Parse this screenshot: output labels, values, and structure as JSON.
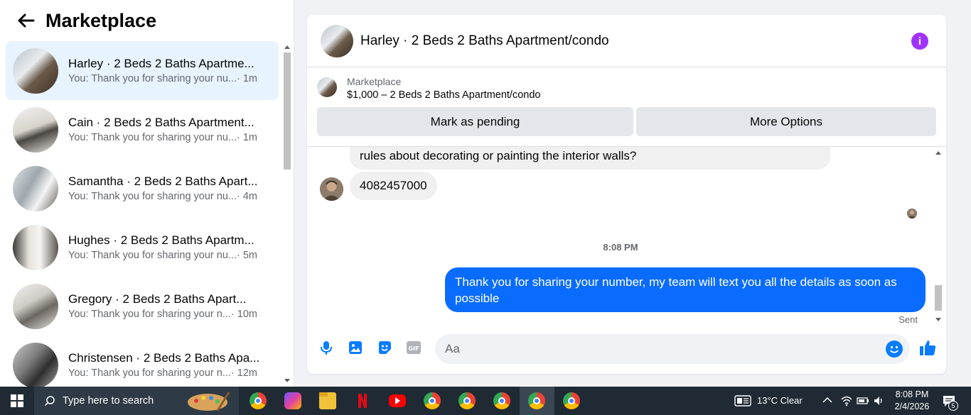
{
  "left": {
    "title": "Marketplace",
    "conversations": [
      {
        "title": "Harley · 2 Beds 2 Baths Apartme...",
        "snippet": "You: Thank you for sharing your nu...",
        "time": "· 1m",
        "active": true
      },
      {
        "title": "Cain · 2 Beds 2 Baths Apartment...",
        "snippet": "You: Thank you for sharing your nu...",
        "time": "· 1m"
      },
      {
        "title": "Samantha · 2 Beds 2 Baths Apart...",
        "snippet": "You: Thank you for sharing your nu...",
        "time": "· 4m"
      },
      {
        "title": "Hughes · 2 Beds 2 Baths Apartm...",
        "snippet": "You: Thank you for sharing your nu...",
        "time": "· 5m"
      },
      {
        "title": "Gregory · 2 Beds 2 Baths Apart...",
        "snippet": "You: Thank you for sharing your n...",
        "time": "· 10m"
      },
      {
        "title": "Christensen · 2 Beds 2 Baths Apa...",
        "snippet": "You: Thank you for sharing your n...",
        "time": "· 12m"
      }
    ]
  },
  "chat": {
    "title": "Harley · 2 Beds 2 Baths Apartment/condo",
    "listing_label": "Marketplace",
    "listing_price": "$1,000 – 2 Beds 2 Baths Apartment/condo",
    "mark_pending": "Mark as pending",
    "more_options": "More Options",
    "msg_in1": "rules about decorating or painting the interior walls?",
    "msg_in2": "4082457000",
    "timestamp": "8:08 PM",
    "msg_out": "Thank you for  sharing your number, my team will text you all the details as soon as possible",
    "sent": "Sent",
    "composer_placeholder": "Aa",
    "accent": "#0a6cff"
  },
  "taskbar": {
    "search_placeholder": "Type here to search",
    "weather": "13°C  Clear",
    "time": "8:08 PM",
    "date": "2/4/2026",
    "notifications": "5"
  }
}
